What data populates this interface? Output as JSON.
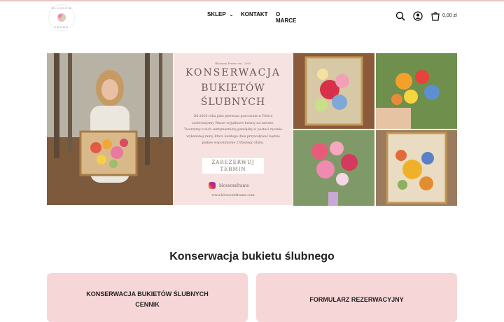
{
  "header": {
    "logo": {
      "text_top": "BLOSSOM",
      "text_bottom": "FRAME"
    },
    "nav": [
      {
        "label": "SKLEP",
        "has_dropdown": true
      },
      {
        "label": "KONTAKT",
        "has_dropdown": false
      },
      {
        "label": "O MARCE",
        "has_dropdown": false
      }
    ],
    "icons": [
      "search-icon",
      "account-icon",
      "cart-icon"
    ],
    "cart_total": "0,00 zł"
  },
  "hero": {
    "card": {
      "small": "Blossom Frame est. 2020",
      "title_line1": "KONSERWACJA",
      "title_line2": "BUKIETÓW",
      "title_line3": "ŚLUBNYCH",
      "paragraph": "Od 2020 roku jako pierwsza pracownia w Polsce zachowujemy Wasze wyjątkowe kwiaty na zawsze. Tworzymy z nich sentymentalną pamiątkę w postaci ręcznie wykonanej ramy, która każdego dnia przywoływać będzie piękne wspomnienie z Waszego ślubu.",
      "button_line1": "ZAREZERWUJ",
      "button_line2": "TERMIN",
      "instagram": "blossomframe",
      "website": "www.blossomframe.com"
    }
  },
  "section": {
    "title": "Konserwacja bukietu ślubnego"
  },
  "cards": {
    "left_line1": "KONSERWACJA BUKIETÓW ŚLUBNYCH",
    "left_line2": "CENNIK",
    "right": "FORMULARZ REZERWACYJNY"
  },
  "colors": {
    "accent": "#e9c4c2",
    "card_bg": "#f7d6d8",
    "hero_card_bg": "#f6e3e1"
  }
}
